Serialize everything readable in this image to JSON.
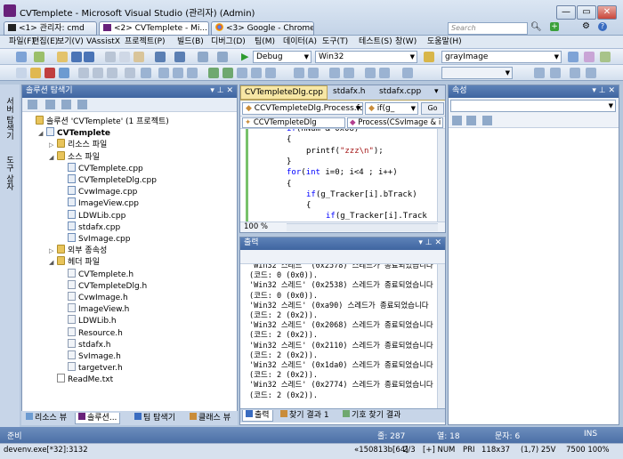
{
  "window": {
    "title": "CVTemplete - Microsoft Visual Studio (관리자) (Admin)",
    "min": "—",
    "max": "▭",
    "close": "✕"
  },
  "tasktabs": [
    {
      "label": "<1> 관리자: cmd"
    },
    {
      "label": "<2> CVTemplete - Mi..."
    },
    {
      "label": "<3> Google - Chrome"
    }
  ],
  "search": {
    "placeholder": "Search"
  },
  "menu": [
    "파일(F)",
    "편집(E)",
    "보기(V)",
    "VAssistX",
    "프로젝트(P)",
    "빌드(B)",
    "디버그(D)",
    "팀(M)",
    "데이터(A)",
    "도구(T)",
    "테스트(S)",
    "창(W)",
    "도움말(H)"
  ],
  "toolbar": {
    "config": "Debug",
    "platform": "Win32",
    "find": "grayImage"
  },
  "lefttabs": [
    "서버 탐색기",
    "도구 상자"
  ],
  "solution": {
    "header": "솔루션 탐색기",
    "root": "솔루션 'CVTemplete' (1 프로젝트)",
    "project": "CVTemplete",
    "resource_folder": "리소스 파일",
    "source_folder": "소스 파일",
    "sources": [
      "CVTemplete.cpp",
      "CVTempleteDlg.cpp",
      "CvwImage.cpp",
      "ImageView.cpp",
      "LDWLib.cpp",
      "stdafx.cpp",
      "SvImage.cpp"
    ],
    "external_folder": "외부 종속성",
    "header_folder": "헤더 파일",
    "headers": [
      "CVTemplete.h",
      "CVTempleteDlg.h",
      "CvwImage.h",
      "ImageView.h",
      "LDWLib.h",
      "Resource.h",
      "stdafx.h",
      "SvImage.h",
      "targetver.h"
    ],
    "readme": "ReadMe.txt"
  },
  "left_bottom_tabs": [
    "리소스 뷰",
    "솔루션...",
    "팀 탐색기",
    "클래스 뷰"
  ],
  "editor": {
    "tabs": [
      "CVTempleteDlg.cpp",
      "stdafx.h",
      "stdafx.cpp"
    ],
    "nav1": "CCVTempleteDlg.Process.fo",
    "nav2": "if(g_",
    "go": "Go",
    "nav3": "CCVTempleteDlg",
    "nav4": "Process(CSvImage & i",
    "zoom": "100 %",
    "lines": [
      {
        "indent": 1,
        "text": "if(nNum & 0x08)"
      },
      {
        "indent": 1,
        "text": "{"
      },
      {
        "indent": 2,
        "text": "printf(\"zzz\\n\");"
      },
      {
        "indent": 1,
        "text": "}"
      },
      {
        "indent": 1,
        "text": "for(int i=0; i<4 ; i++)"
      },
      {
        "indent": 1,
        "text": "{"
      },
      {
        "indent": 2,
        "text": "if(g_Tracker[i].bTrack)"
      },
      {
        "indent": 2,
        "text": "{"
      },
      {
        "indent": 3,
        "text": "if(g_Tracker[i].Track"
      }
    ]
  },
  "output": {
    "header": "출력",
    "lines": [
      "'Win32 스레드' (0x2578) 스레드가 종료되었습니다",
      "(코드: 0 (0x0)).",
      "'Win32 스레드' (0x2538) 스레드가 종료되었습니다",
      "(코드: 0 (0x0)).",
      "'Win32 스레드' (0xa90) 스레드가 종료되었습니다",
      "(코드: 2 (0x2)).",
      "'Win32 스레드' (0x2068) 스레드가 종료되었습니다",
      "(코드: 2 (0x2)).",
      "'Win32 스레드' (0x2110) 스레드가 종료되었습니다",
      "(코드: 2 (0x2)).",
      "'Win32 스레드' (0x1da0) 스레드가 종료되었습니다",
      "(코드: 2 (0x2)).",
      "'Win32 스레드' (0x2774) 스레드가 종료되었습니다",
      "(코드: 2 (0x2))."
    ],
    "tabs": [
      "출력",
      "찾기 결과 1",
      "기호 찾기 결과"
    ]
  },
  "properties": {
    "header": "속성"
  },
  "status": {
    "ready": "준비",
    "line": "줄: 287",
    "col": "열: 18",
    "ch": "문자: 6",
    "ins": "INS"
  },
  "taskbar": {
    "process": "devenv.exe[*32]:3132",
    "addr": "«150813b[64]",
    "pages": "2/3",
    "num": "[+] NUM",
    "pri": "PRI",
    "size": "118x37",
    "pos": "(1,7) 25V",
    "mem": "7500 100%"
  },
  "colors": {
    "accent": "#3f65a0",
    "keyword": "#0000ff",
    "string": "#a31515"
  }
}
